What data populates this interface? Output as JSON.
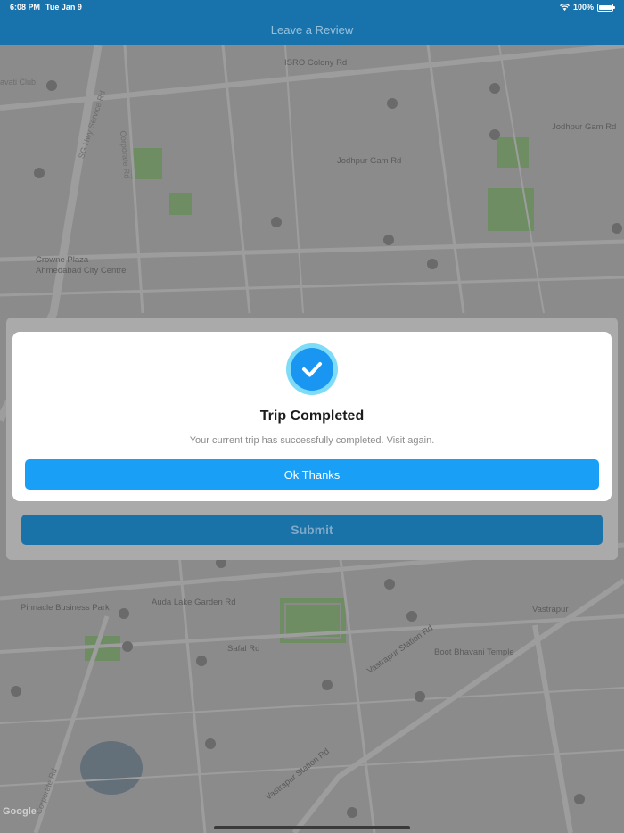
{
  "status_bar": {
    "time": "6:08 PM",
    "date": "Tue Jan 9",
    "battery": "100%"
  },
  "nav": {
    "title": "Leave a Review"
  },
  "map": {
    "labels": {
      "isro": "ISRO Colony Rd",
      "jodhpur1": "Jodhpur Gam Rd",
      "jodhpur2": "Jodhpur Gam Rd",
      "crowne1": "Crowne Plaza",
      "crowne2": "Ahmedabad City Centre",
      "pinnacle": "Pinnacle Business Park",
      "auda": "Auda Lake Garden Rd",
      "safal": "Safal Rd",
      "vastrapur_station": "Vastrapur Station Rd",
      "vastrapur_station2": "Vastrapur Station Rd",
      "boot_bhavani": "Boot Bhavani Temple",
      "vastrapur": "Vastrapur",
      "corporate1": "Corporate Rd",
      "corporate2": "Corporate Rd",
      "sg_hwy": "SG Hwy Service Rd",
      "club": "avati Club",
      "google": "Google"
    }
  },
  "dialog": {
    "icon": "checkmark-circle-icon",
    "title": "Trip Completed",
    "message": "Your current trip has successfully completed. Visit again.",
    "ok_label": "Ok Thanks"
  },
  "sheet": {
    "submit_label": "Submit"
  },
  "colors": {
    "nav": "#1873ad",
    "ok_button": "#19a0f6",
    "submit_button": "#1a73a8",
    "check": "#1996f2"
  }
}
